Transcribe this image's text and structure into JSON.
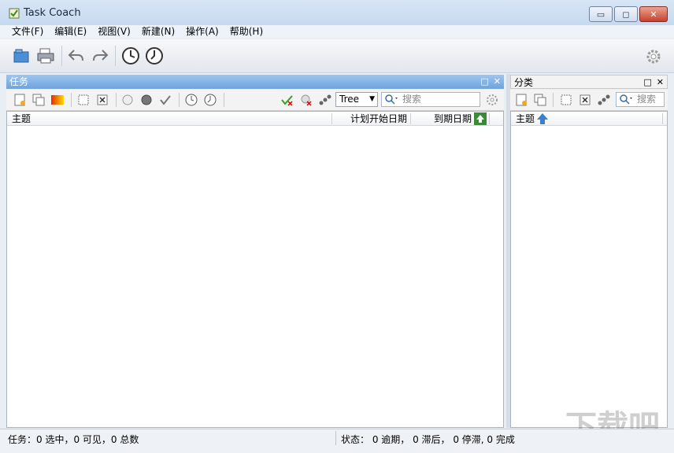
{
  "window": {
    "title": "Task Coach",
    "controls": {
      "minimize": "▭",
      "maximize": "◻",
      "close": "✕"
    }
  },
  "menubar": {
    "items": [
      "文件(F)",
      "编辑(E)",
      "视图(V)",
      "新建(N)",
      "操作(A)",
      "帮助(H)"
    ]
  },
  "main_toolbar": {
    "icons": [
      "open-file-icon",
      "print-icon",
      "undo-icon",
      "redo-icon",
      "start-timer-icon",
      "stop-timer-icon",
      "settings-gear-icon"
    ]
  },
  "tasks_panel": {
    "title": "任务",
    "view_mode": "Tree",
    "search_placeholder": "搜索",
    "columns": [
      "主题",
      "计划开始日期",
      "到期日期"
    ]
  },
  "categories_panel": {
    "title": "分类",
    "search_placeholder": "搜索",
    "columns": [
      "主题"
    ]
  },
  "statusbar": {
    "left": "任务：0 选中，0 可见，0 总数",
    "right": "状态： 0 逾期， 0 滞后， 0 停滞, 0 完成"
  },
  "watermark": "下载吧",
  "colors": {
    "active_panel_header": "#6ea4dc",
    "title_bar": "#c6d9ef"
  }
}
